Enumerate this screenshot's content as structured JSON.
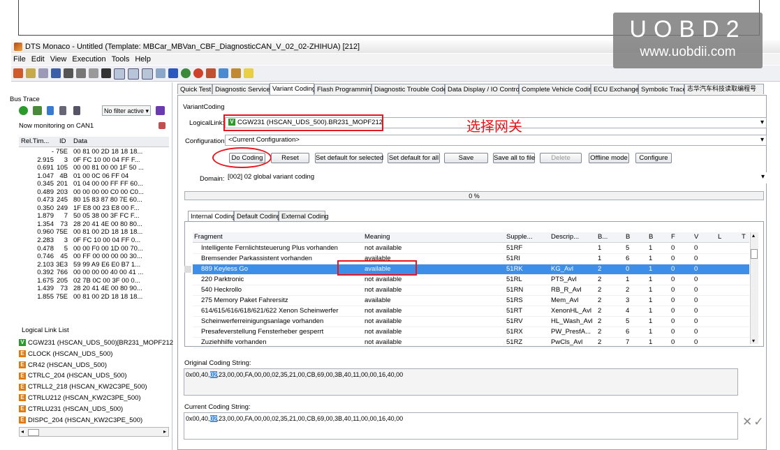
{
  "window": {
    "title": "DTS Monaco - Untitled (Template: MBCar_MBVan_CBF_DiagnosticCAN_V_02_02-ZHIHUA) [212]"
  },
  "watermark": {
    "brand": "UOBD2",
    "url": "www.uobdii.com"
  },
  "menu": [
    "File",
    "Edit",
    "View",
    "Execution",
    "Tools",
    "Help"
  ],
  "bus_trace": {
    "title": "Bus Trace",
    "filter": "No filter active",
    "monitoring": "Now monitoring on CAN1",
    "columns": [
      "Rel.Tim...",
      "ID",
      "Data"
    ],
    "rows": [
      [
        "-",
        "75E",
        "00 81 00 2D 18 18 18..."
      ],
      [
        "2.915",
        "3",
        "0F FC 10 00 04 FF F..."
      ],
      [
        "0.691",
        "105",
        "00 00 81 00 00 1F 50 ..."
      ],
      [
        "1.047",
        "4B",
        "01 00 0C 06 FF 04"
      ],
      [
        "0.345",
        "201",
        "01 04 00 00 FF FF 60..."
      ],
      [
        "0.489",
        "203",
        "00 00 00 00 C0 00 C0..."
      ],
      [
        "0.473",
        "245",
        "80 15 83 87 80 7E 60..."
      ],
      [
        "0.350",
        "249",
        "1F E8 00 23 E8 00 F..."
      ],
      [
        "1.879",
        "7",
        "50 05 38 00 3F FC F..."
      ],
      [
        "1.354",
        "73",
        "28 20 41 4E 00 80 80..."
      ],
      [
        "0.960",
        "75E",
        "00 81 00 2D 18 18 18..."
      ],
      [
        "2.283",
        "3",
        "0F FC 10 00 04 FF 0..."
      ],
      [
        "0.478",
        "5",
        "00 00 F0 00 1D 00 70..."
      ],
      [
        "0.746",
        "45",
        "00 FF 00 00 00 00 30..."
      ],
      [
        "2.103",
        "3E3",
        "59 99 A9 E6 E0 B7 1..."
      ],
      [
        "0.392",
        "766",
        "00 00 00 00 40 00 41 ..."
      ],
      [
        "1.675",
        "205",
        "02 7B 0C 00 3F 00 0..."
      ],
      [
        "1.439",
        "73",
        "28 20 41 4E 00 80 90..."
      ],
      [
        "1.855",
        "75E",
        "00 81 00 2D 18 18 18..."
      ]
    ]
  },
  "logical_link_list": {
    "title": "Logical Link List",
    "items": [
      {
        "badge": "V",
        "color": "#2a9a2a",
        "label": "CGW231 (HSCAN_UDS_500)[BR231_MOPF212"
      },
      {
        "badge": "E",
        "color": "#e07a10",
        "label": "CLOCK (HSCAN_UDS_500)"
      },
      {
        "badge": "E",
        "color": "#e07a10",
        "label": "CR42 (HSCAN_UDS_500)"
      },
      {
        "badge": "E",
        "color": "#e07a10",
        "label": "CTRLC_204 (HSCAN_UDS_500)"
      },
      {
        "badge": "E",
        "color": "#e07a10",
        "label": "CTRLL2_218 (HSCAN_KW2C3PE_500)"
      },
      {
        "badge": "E",
        "color": "#e07a10",
        "label": "CTRLU212 (HSCAN_KW2C3PE_500)"
      },
      {
        "badge": "E",
        "color": "#e07a10",
        "label": "CTRLU231 (HSCAN_UDS_500)"
      },
      {
        "badge": "E",
        "color": "#e07a10",
        "label": "DISPC_204 (HSCAN_KW2C3PE_500)"
      }
    ]
  },
  "tabs": [
    "Quick Test",
    "Diagnostic Services",
    "Variant Coding",
    "Flash Programming",
    "Diagnostic Trouble Code",
    "Data Display / IO Control",
    "Complete Vehicle Coding",
    "ECU Exchange",
    "Symbolic Trace",
    "志华汽车科技读取编程号"
  ],
  "active_tab": "Variant Coding",
  "variant_coding": {
    "section": "VariantCoding",
    "logical_link_label": "LogicalLink:",
    "logical_link_badge": "V",
    "logical_link_value": "CGW231 (HSCAN_UDS_500).BR231_MOPF212",
    "annotation": "选择网关",
    "configuration_label": "Configuration:",
    "configuration_value": "<Current Configuration>",
    "buttons": {
      "do_coding": "Do Coding",
      "reset": "Reset",
      "set_default_selected": "Set default for selected",
      "set_default_all": "Set default for all",
      "save": "Save",
      "save_all": "Save all to file",
      "delete": "Delete",
      "offline": "Offline mode",
      "configure": "Configure"
    },
    "domain_label": "Domain:",
    "domain_value": "[002] 02 global variant coding",
    "progress": "0 %",
    "subtabs": [
      "Internal Coding",
      "Default Coding",
      "External Coding"
    ],
    "grid_columns": [
      "Fragment",
      "Meaning",
      "Supple...",
      "Descrip...",
      "B...",
      "B",
      "B",
      "F",
      "V",
      "L",
      "T"
    ],
    "grid_rows": [
      [
        "Intelligente Fernlichtsteuerung Plus vorhanden",
        "not available",
        "51RF",
        "",
        "1",
        "5",
        "1",
        "0",
        "0"
      ],
      [
        "Bremsender Parkassistent vorhanden",
        "available",
        "51RI",
        "",
        "1",
        "6",
        "1",
        "0",
        "0"
      ],
      [
        "889 Keyless Go",
        "available",
        "51RK",
        "KG_Avl",
        "2",
        "0",
        "1",
        "0",
        "0"
      ],
      [
        "220 Parktronic",
        "not available",
        "51RL",
        "PTS_Avl",
        "2",
        "1",
        "1",
        "0",
        "0"
      ],
      [
        "540 Heckrollo",
        "not available",
        "51RN",
        "RB_R_Avl",
        "2",
        "2",
        "1",
        "0",
        "0"
      ],
      [
        "275 Memory Paket Fahrersitz",
        "available",
        "51RS",
        "Mem_Avl",
        "2",
        "3",
        "1",
        "0",
        "0"
      ],
      [
        "614/615/616/618/621/622 Xenon Scheinwerfer",
        "not available",
        "51RT",
        "XenonHL_Avl",
        "2",
        "4",
        "1",
        "0",
        "0"
      ],
      [
        "Scheinwerferreinigungsanlage vorhanden",
        "not available",
        "51RV",
        "HL_Wash_Avl",
        "2",
        "5",
        "1",
        "0",
        "0"
      ],
      [
        "Presafeverstellung Fensterheber gesperrt",
        "not available",
        "51RX",
        "PW_PresfA...",
        "2",
        "6",
        "1",
        "0",
        "0"
      ],
      [
        "Zuziehhilfe vorhanden",
        "not available",
        "51RZ",
        "PwCls_Avl",
        "2",
        "7",
        "1",
        "0",
        "0"
      ]
    ],
    "selected_row": 2,
    "original_label": "Original Coding String:",
    "original_pre": "0x00,40,",
    "original_hl": "02",
    "original_post": ",23,00,00,FA,00,00,02,35,21,00,CB,69,00,3B,40,11,00,00,16,40,00",
    "current_label": "Current Coding String:",
    "current_pre": "0x00,40,",
    "current_hl": "02",
    "current_post": ",23,00,00,FA,00,00,02,35,21,00,CB,69,00,3B,40,11,00,00,16,40,00",
    "confirm_icons": "✕✓"
  }
}
